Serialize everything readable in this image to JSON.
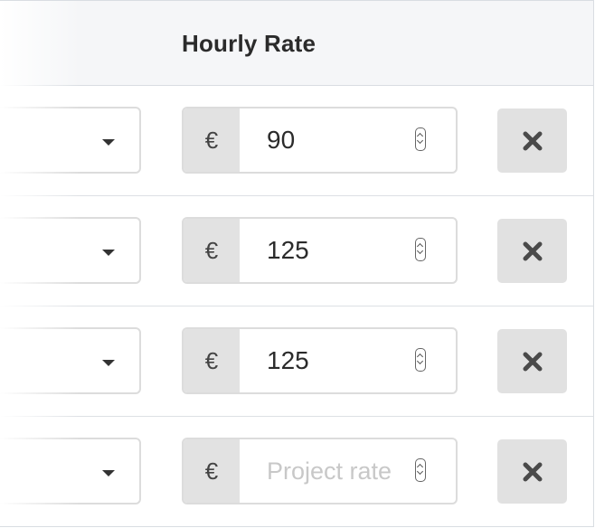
{
  "header": {
    "column_title": "Hourly Rate"
  },
  "rows": [
    {
      "currency": "€",
      "rate": "90",
      "rate_placeholder": "Project rate"
    },
    {
      "currency": "€",
      "rate": "125",
      "rate_placeholder": "Project rate"
    },
    {
      "currency": "€",
      "rate": "125",
      "rate_placeholder": "Project rate"
    },
    {
      "currency": "€",
      "rate": "",
      "rate_placeholder": "Project rate"
    }
  ],
  "icons": {
    "select_caret": "chevron-down-icon",
    "spinner": "spinner-icon",
    "remove": "close-icon"
  },
  "colors": {
    "header_background": "#f5f6f8",
    "addon_background": "#e2e2e2",
    "remove_button_background": "#e1e1e1",
    "placeholder_text": "#c8c8c8"
  }
}
